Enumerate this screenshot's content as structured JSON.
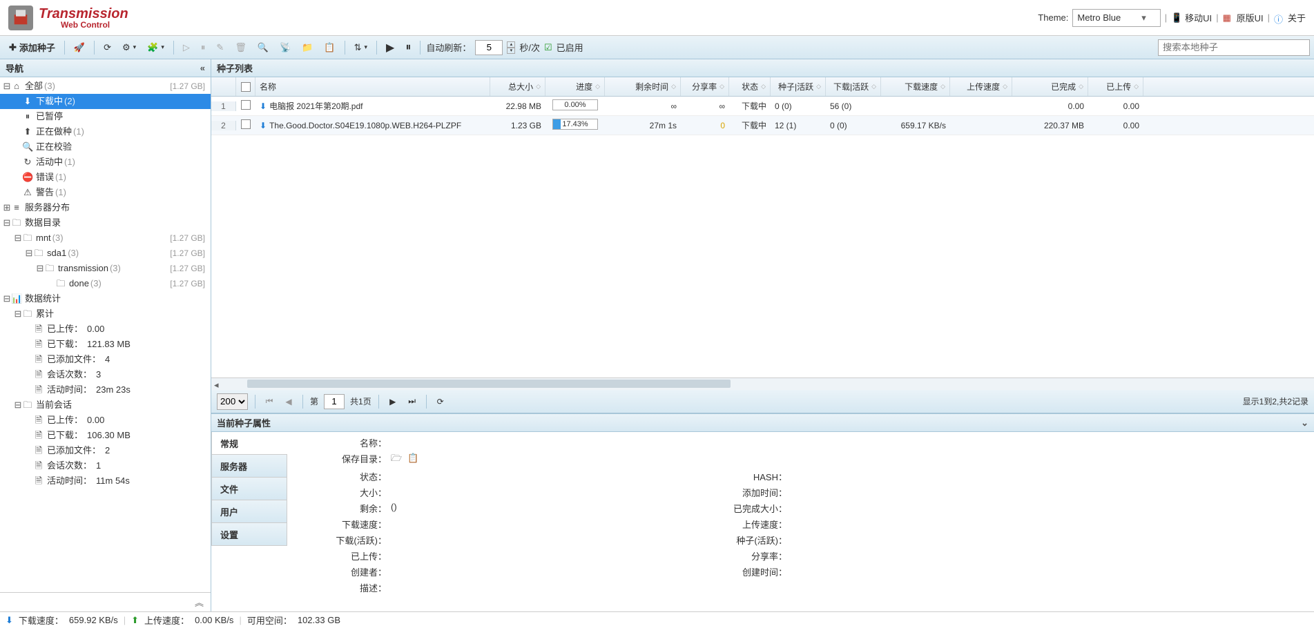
{
  "app": {
    "title": "Transmission",
    "subtitle": "Web Control"
  },
  "header": {
    "theme_label": "Theme:",
    "theme_value": "Metro Blue",
    "mobile_ui": "移动UI",
    "original_ui": "原版UI",
    "about": "关于"
  },
  "toolbar": {
    "add_torrent": "添加种子",
    "auto_refresh_label": "自动刷新：",
    "refresh_interval": "5",
    "refresh_unit": "秒/次",
    "enabled_label": "已启用",
    "search_placeholder": "搜索本地种子"
  },
  "sidebar": {
    "title": "导航",
    "tree": [
      {
        "id": "all",
        "label": "全部",
        "count": "(3)",
        "size": "[1.27 GB]",
        "indent": 0,
        "toggle": "⊟",
        "icon": "⌂"
      },
      {
        "id": "downloading",
        "label": "下载中",
        "count": "(2)",
        "indent": 1,
        "icon": "⬇",
        "selected": true
      },
      {
        "id": "paused",
        "label": "已暂停",
        "indent": 1,
        "icon": "⏸"
      },
      {
        "id": "seeding",
        "label": "正在做种",
        "count": "(1)",
        "indent": 1,
        "icon": "⬆"
      },
      {
        "id": "checking",
        "label": "正在校验",
        "indent": 1,
        "icon": "🔍"
      },
      {
        "id": "active",
        "label": "活动中",
        "count": "(1)",
        "indent": 1,
        "icon": "↻"
      },
      {
        "id": "error",
        "label": "错误",
        "count": "(1)",
        "indent": 1,
        "icon": "⛔"
      },
      {
        "id": "warning",
        "label": "警告",
        "count": "(1)",
        "indent": 1,
        "icon": "⚠"
      },
      {
        "id": "trackers",
        "label": "服务器分布",
        "indent": 0,
        "toggle": "⊞",
        "icon": "≡"
      },
      {
        "id": "data-dir",
        "label": "数据目录",
        "indent": 0,
        "toggle": "⊟",
        "icon": "🗀"
      },
      {
        "id": "mnt",
        "label": "mnt",
        "count": "(3)",
        "size": "[1.27 GB]",
        "indent": 1,
        "toggle": "⊟",
        "icon": "🗀"
      },
      {
        "id": "sda1",
        "label": "sda1",
        "count": "(3)",
        "size": "[1.27 GB]",
        "indent": 2,
        "toggle": "⊟",
        "icon": "🗀"
      },
      {
        "id": "transmission",
        "label": "transmission",
        "count": "(3)",
        "size": "[1.27 GB]",
        "indent": 3,
        "toggle": "⊟",
        "icon": "🗀"
      },
      {
        "id": "done",
        "label": "done",
        "count": "(3)",
        "size": "[1.27 GB]",
        "indent": 4,
        "icon": "🗀"
      },
      {
        "id": "stats",
        "label": "数据统计",
        "indent": 0,
        "toggle": "⊟",
        "icon": "📊"
      },
      {
        "id": "total",
        "label": "累计",
        "indent": 1,
        "toggle": "⊟",
        "icon": "🗀"
      },
      {
        "id": "t-up",
        "label": "已上传：",
        "val": "0.00",
        "indent": 2,
        "icon": "🗎"
      },
      {
        "id": "t-down",
        "label": "已下载：",
        "val": "121.83 MB",
        "indent": 2,
        "icon": "🗎"
      },
      {
        "id": "t-files",
        "label": "已添加文件：",
        "val": "4",
        "indent": 2,
        "icon": "🗎"
      },
      {
        "id": "t-sess",
        "label": "会话次数：",
        "val": "3",
        "indent": 2,
        "icon": "🗎"
      },
      {
        "id": "t-time",
        "label": "活动时间：",
        "val": "23m 23s",
        "indent": 2,
        "icon": "🗎"
      },
      {
        "id": "session",
        "label": "当前会话",
        "indent": 1,
        "toggle": "⊟",
        "icon": "🗀"
      },
      {
        "id": "s-up",
        "label": "已上传：",
        "val": "0.00",
        "indent": 2,
        "icon": "🗎"
      },
      {
        "id": "s-down",
        "label": "已下载：",
        "val": "106.30 MB",
        "indent": 2,
        "icon": "🗎"
      },
      {
        "id": "s-files",
        "label": "已添加文件：",
        "val": "2",
        "indent": 2,
        "icon": "🗎"
      },
      {
        "id": "s-sess",
        "label": "会话次数：",
        "val": "1",
        "indent": 2,
        "icon": "🗎"
      },
      {
        "id": "s-time",
        "label": "活动时间：",
        "val": "11m 54s",
        "indent": 2,
        "icon": "🗎"
      }
    ]
  },
  "grid": {
    "title": "种子列表",
    "columns": [
      "",
      "",
      "名称",
      "总大小",
      "进度",
      "剩余时间",
      "分享率",
      "状态",
      "种子|活跃",
      "下载|活跃",
      "下载速度",
      "上传速度",
      "已完成",
      "已上传"
    ],
    "rows": [
      {
        "num": "1",
        "name": "电脑报 2021年第20期.pdf",
        "size": "22.98 MB",
        "progress": "0.00%",
        "progress_pct": 0,
        "remaining": "∞",
        "ratio": "∞",
        "status": "下载中",
        "seeds": "0 (0)",
        "peers": "56 (0)",
        "dl": "",
        "ul": "",
        "done": "0.00",
        "uploaded": "0.00"
      },
      {
        "num": "2",
        "name": "The.Good.Doctor.S04E19.1080p.WEB.H264-PLZPF",
        "size": "1.23 GB",
        "progress": "17.43%",
        "progress_pct": 17.43,
        "remaining": "27m 1s",
        "ratio": "0",
        "ratio_color": "#d9a400",
        "status": "下载中",
        "seeds": "12 (1)",
        "peers": "0 (0)",
        "dl": "659.17 KB/s",
        "ul": "",
        "done": "220.37 MB",
        "uploaded": "0.00"
      }
    ]
  },
  "pager": {
    "page_size": "200",
    "page_label": "第",
    "page_current": "1",
    "page_total": "共1页",
    "info": "显示1到2,共2记录"
  },
  "props": {
    "title": "当前种子属性",
    "tabs": [
      "常规",
      "服务器",
      "文件",
      "用户",
      "设置"
    ],
    "left_labels": [
      "名称：",
      "保存目录：",
      "状态：",
      "大小：",
      "剩余：",
      "下载速度：",
      "下载(活跃)：",
      "已上传：",
      "创建者：",
      "描述："
    ],
    "right_labels": [
      "",
      "",
      "HASH：",
      "添加时间：",
      "已完成大小：",
      "上传速度：",
      "种子(活跃)：",
      "分享率：",
      "创建时间：",
      ""
    ],
    "remaining_val": "()"
  },
  "statusbar": {
    "dl_label": "下载速度：",
    "dl_value": "659.92 KB/s",
    "ul_label": "上传速度：",
    "ul_value": "0.00 KB/s",
    "space_label": "可用空间：",
    "space_value": "102.33 GB"
  }
}
